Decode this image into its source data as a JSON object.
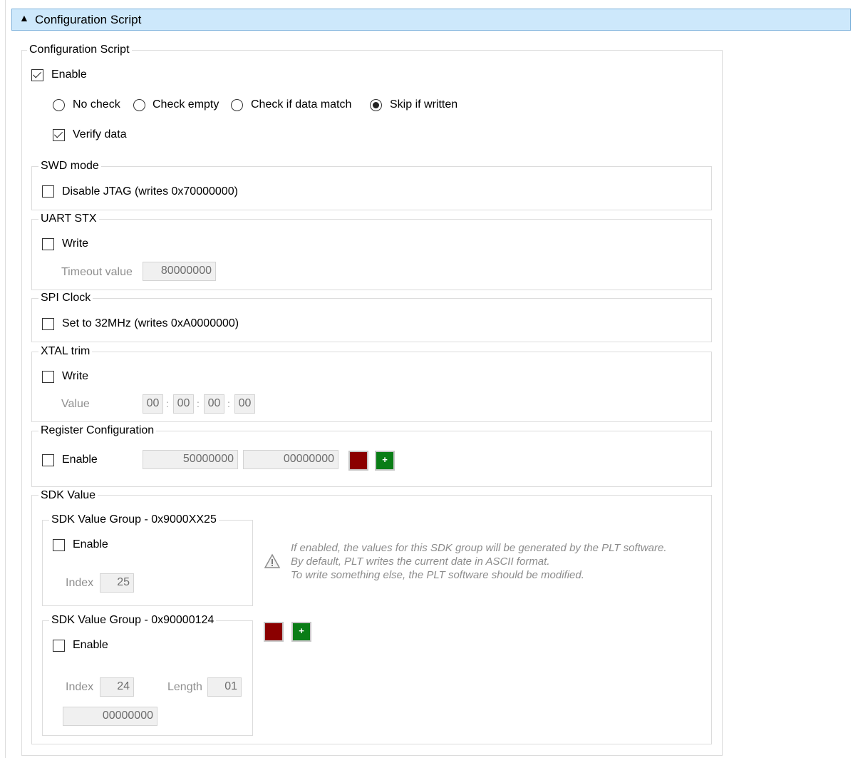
{
  "header": {
    "title": "Configuration Script"
  },
  "config": {
    "legend": "Configuration Script",
    "enable_label": "Enable",
    "radios": [
      {
        "label": "No check",
        "selected": false
      },
      {
        "label": "Check empty",
        "selected": false
      },
      {
        "label": "Check if data match",
        "selected": false
      },
      {
        "label": "Skip if written",
        "selected": true
      }
    ],
    "verify_label": "Verify data"
  },
  "swd": {
    "legend": "SWD mode",
    "checkbox_label": "Disable JTAG (writes 0x70000000)"
  },
  "uart": {
    "legend": "UART STX",
    "checkbox_label": "Write",
    "timeout_label": "Timeout value",
    "timeout_value": "80000000"
  },
  "spi": {
    "legend": "SPI Clock",
    "checkbox_label": "Set to 32MHz (writes 0xA0000000)"
  },
  "xtal": {
    "legend": "XTAL trim",
    "checkbox_label": "Write",
    "value_label": "Value",
    "bytes": [
      "00",
      "00",
      "00",
      "00"
    ],
    "separator": ":"
  },
  "register": {
    "legend": "Register Configuration",
    "checkbox_label": "Enable",
    "address": "50000000",
    "value": "00000000",
    "add_symbol": "+"
  },
  "sdk": {
    "legend": "SDK Value",
    "group1": {
      "legend": "SDK Value Group - 0x9000XX25",
      "checkbox_label": "Enable",
      "index_label": "Index",
      "index_value": "25"
    },
    "note_lines": [
      "If enabled, the values for this SDK group will be generated by the PLT software.",
      "By default, PLT writes the current date in ASCII format.",
      "To write something else, the PLT software should be modified."
    ],
    "group2": {
      "legend": "SDK Value Group - 0x90000124",
      "checkbox_label": "Enable",
      "index_label": "Index",
      "index_value": "24",
      "length_label": "Length",
      "length_value": "01",
      "data_value": "00000000"
    },
    "add_symbol": "+"
  },
  "colors": {
    "header_bg": "#cde8fb",
    "remove_button": "#8b0000",
    "add_button": "#0a7d16"
  }
}
